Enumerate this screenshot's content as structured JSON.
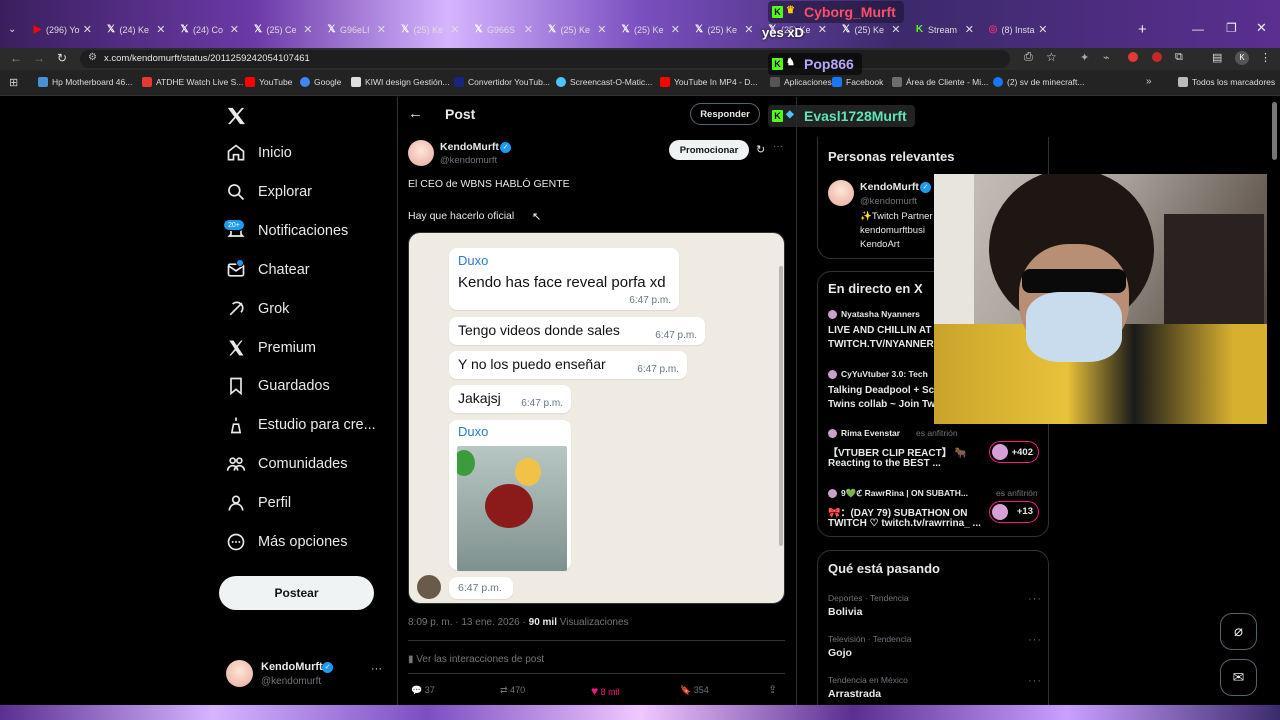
{
  "tabs": [
    {
      "label": "(296) Yo",
      "icon": "youtube-icon"
    },
    {
      "label": "(24) Ke",
      "icon": "x-icon"
    },
    {
      "label": "(24) Co",
      "icon": "x-icon"
    },
    {
      "label": "(25) Ce",
      "icon": "x-icon"
    },
    {
      "label": "G96eLI",
      "icon": "x-icon"
    },
    {
      "label": "(25) Ke",
      "icon": "x-icon"
    },
    {
      "label": "G966S",
      "icon": "x-icon"
    },
    {
      "label": "(25) Ke",
      "icon": "x-icon"
    },
    {
      "label": "(25) Ke",
      "icon": "x-icon"
    },
    {
      "label": "(25) Ke",
      "icon": "x-icon"
    },
    {
      "label": "(25) Ke",
      "icon": "x-icon"
    },
    {
      "label": "(25) Ke",
      "icon": "x-icon"
    },
    {
      "label": "Stream",
      "icon": "kick-icon"
    },
    {
      "label": "(8) Insta",
      "icon": "instagram-icon"
    }
  ],
  "address": {
    "url": "x.com/kendomurft/status/2011259242054107461"
  },
  "bookmarks": [
    "Hp Motherboard 46...",
    "ATDHE Watch Live S...",
    "YouTube",
    "Google",
    "KIWI design Gestión...",
    "Convertidor YouTub...",
    "Screencast-O-Matic...",
    "YouTube In MP4 - D...",
    "Aplicaciones",
    "Facebook",
    "Área de Cliente - Mi...",
    "(2) sv de minecraft...",
    "Todos los marcadores"
  ],
  "overlay_chat": [
    {
      "user": "Cyborg_Murft",
      "color": "#ff4d6d"
    },
    {
      "text": "yes xD"
    },
    {
      "user": "Pop866",
      "color": "#b9a7ff"
    },
    {
      "user": "Evasl1728Murft",
      "color": "#5ce5b5"
    }
  ],
  "sidebar": {
    "items": [
      "Inicio",
      "Explorar",
      "Notificaciones",
      "Chatear",
      "Grok",
      "Premium",
      "Guardados",
      "Estudio para cre...",
      "Comunidades",
      "Perfil",
      "Más opciones"
    ],
    "notif_badge": "20+",
    "post_button": "Postear",
    "account": {
      "name": "KendoMurft",
      "handle": "@kendomurft"
    }
  },
  "header": {
    "title": "Post",
    "reply_button": "Responder"
  },
  "post": {
    "author": "KendoMurft",
    "handle": "@kendomurft",
    "promote": "Promocionar",
    "text1": "El CEO de WBNS HABLÓ GENTE",
    "text2": "Hay que hacerlo oficial",
    "meta_time": "8:09 p. m. · 13 ene. 2026 ·",
    "meta_views": "90 mil",
    "meta_views_label": "Visualizaciones",
    "interactions": "Ver las interacciones de post",
    "stats": {
      "replies": "37",
      "reposts": "470",
      "likes": "8 mil",
      "bookmarks": "354"
    }
  },
  "chat": {
    "messages": [
      {
        "sender": "Duxo",
        "text": "Kendo has face reveal porfa xd",
        "time": "6:47 p.m."
      },
      {
        "text": "Tengo videos donde sales",
        "time": "6:47 p.m."
      },
      {
        "text": "Y no los puedo enseñar",
        "time": "6:47 p.m."
      },
      {
        "text": "Jakajsj",
        "time": "6:47 p.m."
      }
    ],
    "gif_sender": "Duxo",
    "gif_time": "6:47 p.m."
  },
  "right": {
    "relevant_title": "Personas relevantes",
    "relevant": {
      "name": "KendoMurft",
      "handle": "@kendomurft",
      "bio1": "✨Twitch Partner",
      "bio2": "kendomurftbusi",
      "bio3": "KendoArt"
    },
    "live_title": "En directo en X",
    "lives": [
      {
        "host": "Nyatasha Nyanners",
        "title1": "LIVE AND CHILLIN AT",
        "title2": "TWITCH.TV/NYANNER"
      },
      {
        "host": "CyYuVtuber 3.0: Tech",
        "title1": "Talking Deadpool + Sc",
        "title2": "Twins collab ~ Join Tw"
      },
      {
        "host": "Rima Evenstar",
        "role": "es anfitrión",
        "title1": "【VTUBER CLIP REACT】 🐂",
        "title2": "Reacting to the BEST ...",
        "count": "+402"
      },
      {
        "host": "9💚ℭ RawrRina | ON SUBATH...",
        "role": "es anfitrión",
        "title1": "🎀：(DAY 79) SUBATHON ON",
        "title2": "TWITCH ♡ twitch.tv/rawrrina_ ...",
        "count": "+13"
      }
    ],
    "happening_title": "Qué está pasando",
    "trends": [
      {
        "label": "Deportes · Tendencia",
        "value": "Bolivia"
      },
      {
        "label": "Televisión · Tendencia",
        "value": "Gojo"
      },
      {
        "label": "Tendencia en México",
        "value": "Arrastrada"
      }
    ]
  },
  "colors": {
    "accent": "#1d9bf0",
    "like": "#f91880",
    "chat_bg": "#efeae2"
  }
}
